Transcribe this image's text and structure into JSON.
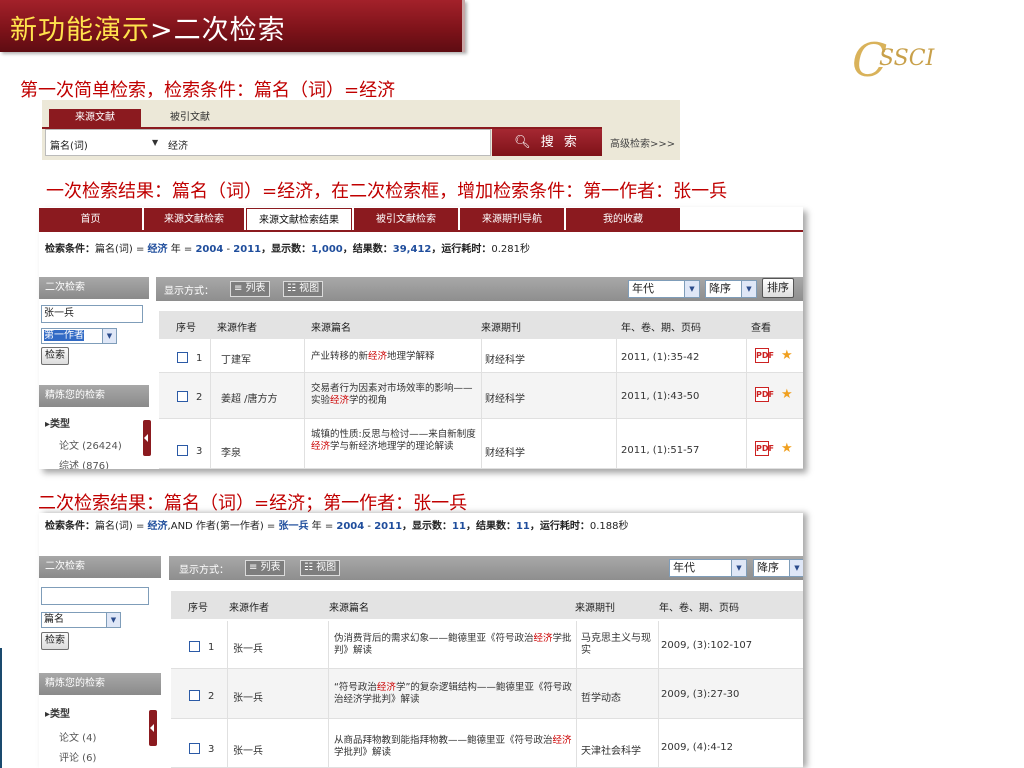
{
  "slide": {
    "title_highlight": "新功能演示",
    "title_rest": ">二次检索",
    "logo_c": "C",
    "logo_text": "SSCI"
  },
  "captions": {
    "first": "第一次简单检索，检索条件：篇名（词）=经济",
    "second": "一次检索结果：篇名（词）=经济，在二次检索框，增加检索条件：第一作者：张一兵",
    "third": "二次检索结果：篇名（词）=经济；第一作者：张一兵"
  },
  "search": {
    "tabs": [
      "来源文献",
      "被引文献"
    ],
    "field": "篇名(词)",
    "value": "经济",
    "button": "搜 索",
    "advanced": "高级检索>>>"
  },
  "nav": [
    "首页",
    "来源文献检索",
    "来源文献检索结果",
    "被引文献检索",
    "来源期刊导航",
    "我的收藏"
  ],
  "result1": {
    "cond_label": "检索条件：",
    "cond_field": "篇名(词) = ",
    "cond_kw": "经济",
    "cond_year": " 年 = ",
    "year_from": "2004",
    "year_sep": " - ",
    "year_to": "2011",
    "shown_label": "，显示数：",
    "shown": "1,000",
    "total_label": "，结果数：",
    "total": "39,412",
    "time_label": "，运行耗时：",
    "time": "0.281秒",
    "sidebar": {
      "head": "二次检索",
      "input": "张一兵",
      "select": "第一作者",
      "button": "检索",
      "refine": "精炼您的检索",
      "type": "▸类型",
      "lines": [
        "论文 (26424)",
        "综述 (876)"
      ]
    },
    "display_label": "显示方式：",
    "view_list": "≡ 列表",
    "view_grid": "☷ 视图",
    "sort_field": "年代",
    "sort_order": "降序",
    "sort_button": "排序",
    "headers": [
      "序号",
      "来源作者",
      "来源篇名",
      "来源期刊",
      "年、卷、期、页码",
      "查看"
    ],
    "rows": [
      {
        "no": "1",
        "author": "丁建军",
        "t1": "产业转移的新",
        "tk": "经济",
        "t2": "地理学解释",
        "journal": "财经科学",
        "vol": "2011, (1):35-42"
      },
      {
        "no": "2",
        "author": "姜超 /唐方方",
        "t1": "交易者行为因素对市场效率的影响——实验",
        "tk": "经济",
        "t2": "学的视角",
        "journal": "财经科学",
        "vol": "2011, (1):43-50"
      },
      {
        "no": "3",
        "author": "李泉",
        "t1": "城镇的性质:反思与检讨——来自新制度",
        "tk": "经济",
        "t2": "学与新经济地理学的理论解读",
        "journal": "财经科学",
        "vol": "2011, (1):51-57"
      }
    ]
  },
  "result2": {
    "cond_label": "检索条件：",
    "cond_field": "篇名(词) = ",
    "cond_kw": "经济",
    "cond_and": ",AND 作者(第一作者) = ",
    "cond_author": "张一兵",
    "cond_year": " 年 = ",
    "year_from": "2004",
    "year_sep": " - ",
    "year_to": "2011",
    "shown_label": "，显示数：",
    "shown": "11",
    "total_label": "，结果数：",
    "total": "11",
    "time_label": "，运行耗时：",
    "time": "0.188秒",
    "sidebar": {
      "head": "二次检索",
      "input": "",
      "select": "篇名",
      "button": "检索",
      "refine": "精炼您的检索",
      "type": "▸类型",
      "lines": [
        "论文 (4)",
        "评论 (6)"
      ]
    },
    "display_label": "显示方式：",
    "view_list": "≡ 列表",
    "view_grid": "☷ 视图",
    "sort_field": "年代",
    "sort_order": "降序",
    "headers": [
      "序号",
      "来源作者",
      "来源篇名",
      "来源期刊",
      "年、卷、期、页码"
    ],
    "rows": [
      {
        "no": "1",
        "author": "张一兵",
        "t1": "伪消费背后的需求幻象——鲍德里亚《符号政治",
        "tk": "经济",
        "t2": "学批判》解读",
        "journal": "马克思主义与现实",
        "vol": "2009, (3):102-107"
      },
      {
        "no": "2",
        "author": "张一兵",
        "t1": "“符号政治",
        "tk": "经济",
        "t2": "学”的复杂逻辑结构——鲍德里亚《符号政治经济学批判》解读",
        "journal": "哲学动态",
        "vol": "2009, (3):27-30"
      },
      {
        "no": "3",
        "author": "张一兵",
        "t1": "从商品拜物教到能指拜物教——鲍德里亚《符号政治",
        "tk": "经济",
        "t2": "学批判》解读",
        "journal": "天津社会科学",
        "vol": "2009, (4):4-12"
      }
    ]
  }
}
